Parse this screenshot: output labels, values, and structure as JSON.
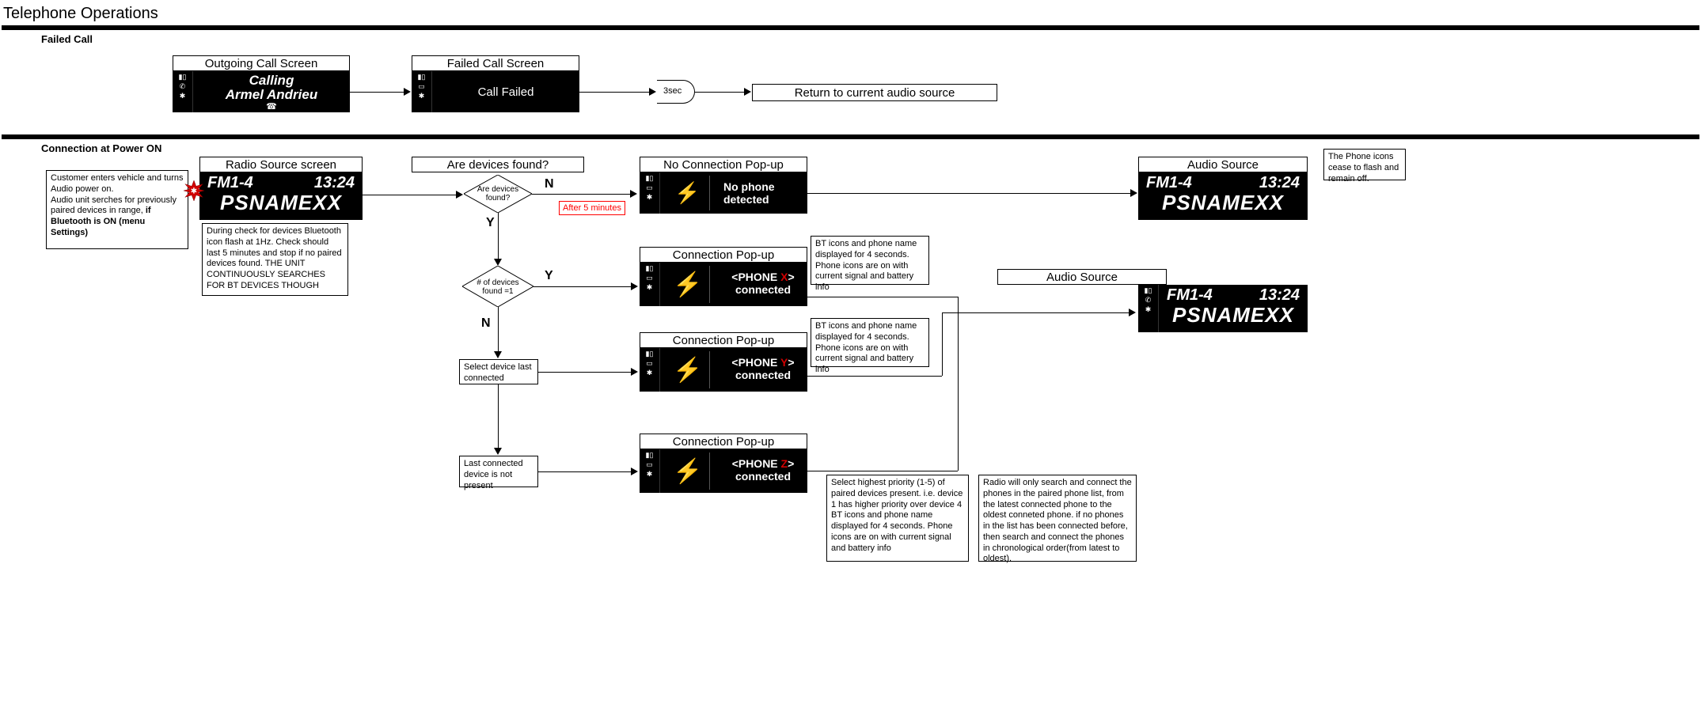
{
  "page_title": "Telephone Operations",
  "sections": {
    "failed_call": "Failed Call",
    "connection": "Connection at Power ON"
  },
  "labels": {
    "outgoing_call_screen": "Outgoing Call Screen",
    "failed_call_screen": "Failed Call Screen",
    "return_audio": "Return to current audio source",
    "radio_source": "Radio Source screen",
    "are_devices_found": "Are devices found?",
    "no_connection_popup": "No Connection Pop-up",
    "audio_source": "Audio Source",
    "connection_popup": "Connection Pop-up",
    "select_last": "Select device last connected",
    "last_not_present": "Last connected device is not present",
    "three_sec": "3sec",
    "after_5_min": "After 5 minutes",
    "Y": "Y",
    "N": "N"
  },
  "diamonds": {
    "d1": "Are devices found?",
    "d2": "# of devices found =1"
  },
  "screens": {
    "calling": {
      "line1": "Calling",
      "line2": "Armel Andrieu"
    },
    "call_failed": "Call Failed",
    "radio": {
      "band": "FM1-4",
      "time": "13:24",
      "name": "PSNAMEXX"
    },
    "no_phone": {
      "line1": "No phone",
      "line2": "detected"
    },
    "phone_x": {
      "name": "<PHONE X>",
      "status": "connected",
      "letter": "X",
      "prefix": "<PHONE ",
      "suffix": ">"
    },
    "phone_y": {
      "name": "<PHONE Y>",
      "status": "connected",
      "letter": "Y",
      "prefix": "<PHONE ",
      "suffix": ">"
    },
    "phone_z": {
      "name": "<PHONE Z>",
      "status": "connected",
      "letter": "Z",
      "prefix": "<PHONE ",
      "suffix": ">"
    }
  },
  "notes": {
    "customer": "Customer enters vehicle and turns Audio power on.\nAudio unit serches for previously paired devices in range, if Bluetooth is ON (menu Settings)",
    "customer_p1": "Customer enters vehicle and turns Audio power on.",
    "customer_p2": "Audio unit serches for previously paired devices in range, ",
    "customer_p3_bold": "if Bluetooth is ON (menu Settings)",
    "bt_check": "During check for devices Bluetooth icon flash at 1Hz.\nCheck should last 5 minutes and stop if no paired devices found. THE UNIT CONTINUOUSLY SEARCHES FOR BT DEVICES THOUGH",
    "phone_icons_off": "The Phone icons cease to flash and remain off.",
    "bt_icons_4s": "BT icons and phone name displayed for 4 seconds. Phone icons are on with current signal and battery info",
    "priority": "Select highest priority (1-5) of paired devices present. i.e. device 1 has higher priority over device 4\nBT icons and phone name displayed for 4 seconds. Phone icons are on with current signal and battery info",
    "search_order": "Radio will only search and connect the phones in the paired phone list, from the latest connected phone to the oldest conneted phone. if no phones in the list has been connected before, then search and connect the phones in chronological order(from latest to oldest)."
  }
}
